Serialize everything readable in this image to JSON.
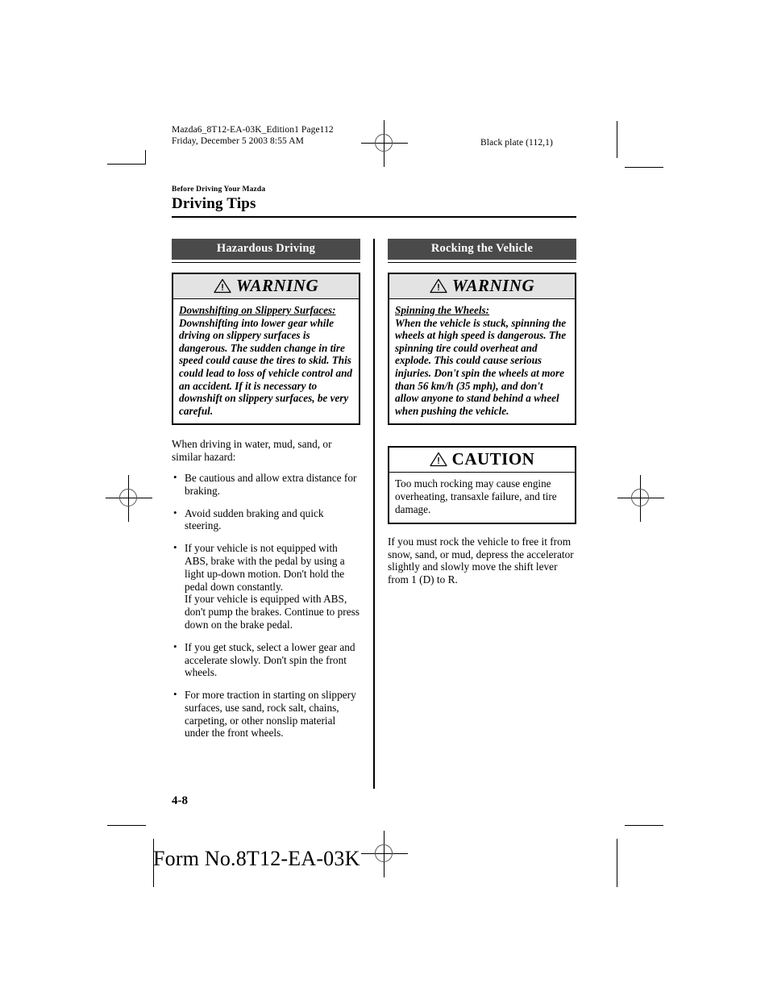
{
  "prepress": {
    "slug_left": "Mazda6_8T12-EA-03K_Edition1 Page112\nFriday, December 5 2003 8:55 AM",
    "slug_right": "Black plate (112,1)",
    "folio": "4-8",
    "form_no": "Form No.8T12-EA-03K"
  },
  "header": {
    "kicker": "Before Driving Your Mazda",
    "title": "Driving Tips"
  },
  "left_column": {
    "section_title": "Hazardous Driving",
    "warning": {
      "label": "WARNING",
      "lead": "Downshifting on Slippery Surfaces:",
      "text": "Downshifting into lower gear while driving on slippery surfaces is dangerous. The sudden change in tire speed could cause the tires to skid. This could lead to loss of vehicle control and an accident. If it is necessary to downshift on slippery surfaces, be very careful."
    },
    "intro": "When driving in water, mud, sand, or similar hazard:",
    "bullets": [
      {
        "text": "Be cautious and allow extra distance for braking.",
        "continuation": ""
      },
      {
        "text": "Avoid sudden braking and quick steering.",
        "continuation": ""
      },
      {
        "text": "If your vehicle is not equipped with ABS, brake with the pedal by using a light up-down motion. Don't hold the pedal down constantly.",
        "continuation": "If your vehicle is equipped with ABS, don't pump the brakes. Continue to press down on the brake pedal."
      },
      {
        "text": "If you get stuck, select a lower gear and accelerate slowly. Don't spin the front wheels.",
        "continuation": ""
      },
      {
        "text": "For more traction in starting on slippery surfaces, use sand, rock salt, chains, carpeting, or other nonslip material under the front wheels.",
        "continuation": ""
      }
    ]
  },
  "right_column": {
    "section_title": "Rocking the Vehicle",
    "warning": {
      "label": "WARNING",
      "lead": "Spinning the Wheels:",
      "text": "When the vehicle is stuck, spinning the wheels at high speed is dangerous. The spinning tire could overheat and explode. This could cause serious injuries. Don't spin the wheels at more than 56 km/h (35 mph), and don't allow anyone to stand behind a wheel when pushing the vehicle."
    },
    "caution": {
      "label": "CAUTION",
      "text": "Too much rocking may cause engine overheating, transaxle failure, and tire damage."
    },
    "body": "If you must rock the vehicle to free it from snow, sand, or mud, depress the accelerator slightly and slowly move the shift lever from 1 (D) to R."
  },
  "colors": {
    "section_bar": "#4a4a4a",
    "warning_head": "#e3e3e3",
    "rule": "#000000"
  }
}
